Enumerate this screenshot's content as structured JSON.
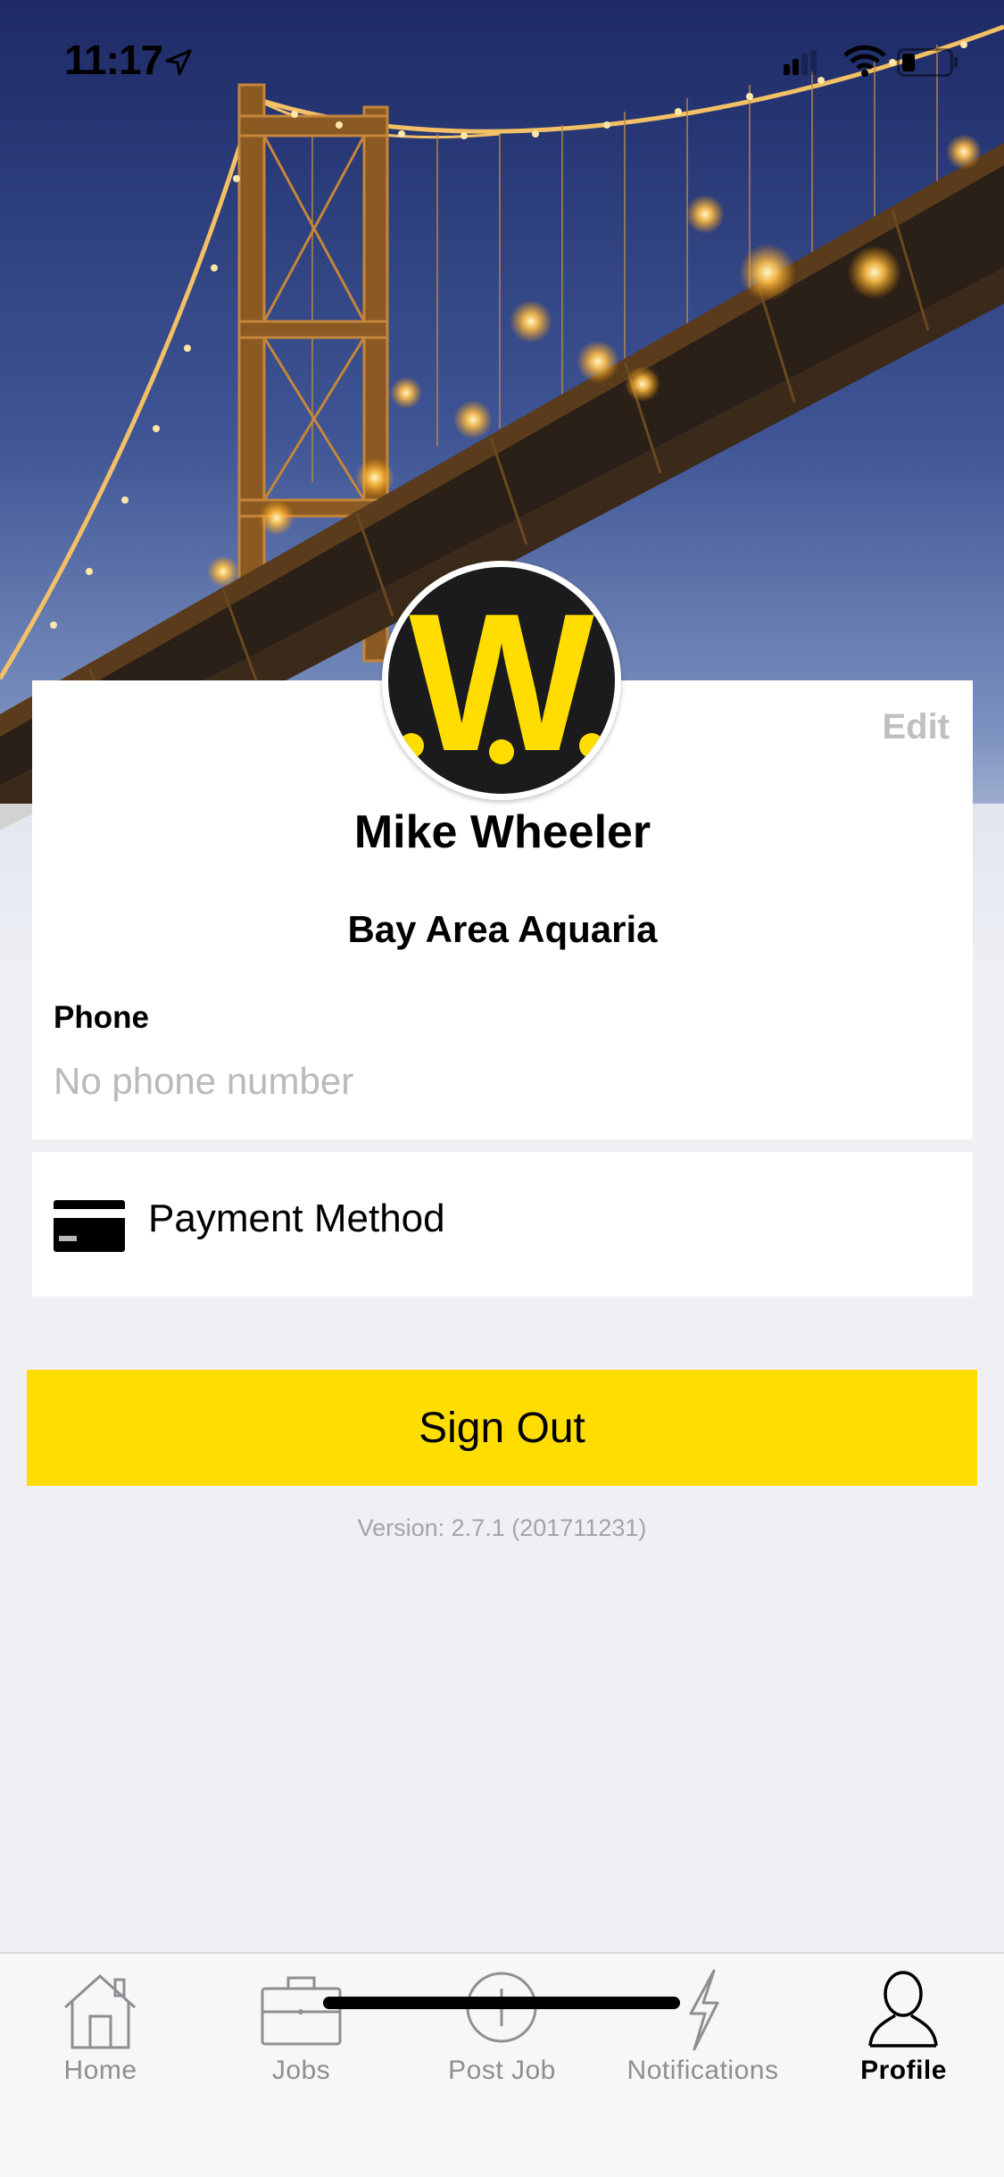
{
  "status_bar": {
    "time": "11:17"
  },
  "profile": {
    "edit_label": "Edit",
    "name": "Mike Wheeler",
    "company": "Bay Area Aquaria",
    "phone_label": "Phone",
    "phone_value": "No phone number",
    "avatar_logo": "W"
  },
  "payment": {
    "label": "Payment Method",
    "icon": "credit-card-icon"
  },
  "signout_label": "Sign Out",
  "version_text": "Version: 2.7.1 (201711231)",
  "tabs": [
    {
      "label": "Home",
      "icon": "home-icon"
    },
    {
      "label": "Jobs",
      "icon": "briefcase-icon"
    },
    {
      "label": "Post Job",
      "icon": "plus-circle-icon"
    },
    {
      "label": "Notifications",
      "icon": "lightning-icon"
    },
    {
      "label": "Profile",
      "icon": "person-icon",
      "active": true
    }
  ],
  "colors": {
    "accent": "#ffdd00",
    "background": "#efeff4",
    "avatar_bg": "#1b1a1c"
  }
}
